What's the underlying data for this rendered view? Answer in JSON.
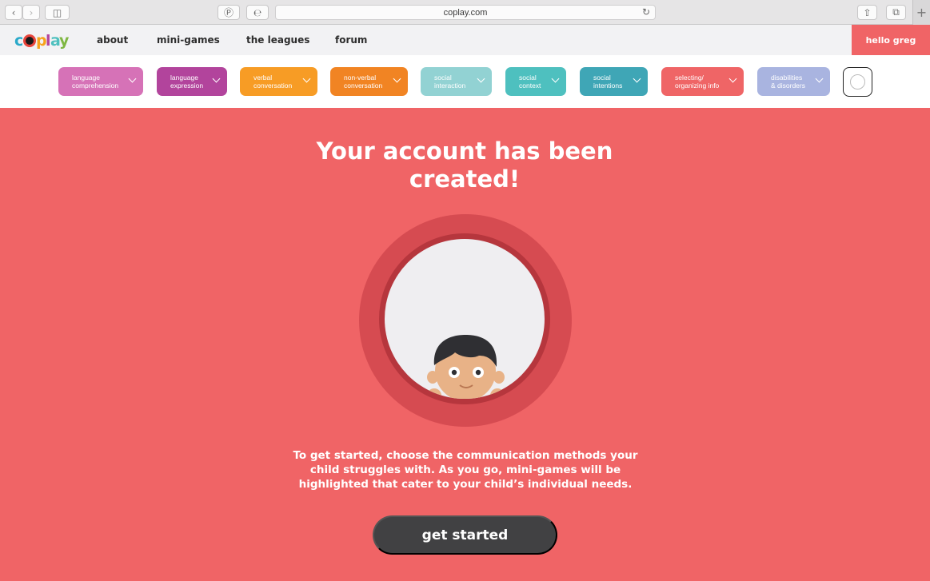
{
  "browser": {
    "url": "coplay.com"
  },
  "nav": {
    "logo": "coplay",
    "links": [
      "about",
      "mini-games",
      "the leagues",
      "forum"
    ],
    "greeting": "hello greg"
  },
  "categories": [
    {
      "label": "language\ncomprehension",
      "color": "#d672b7"
    },
    {
      "label": "language\nexpression",
      "color": "#b2449c"
    },
    {
      "label": "verbal\nconversation",
      "color": "#f79c25"
    },
    {
      "label": "non-verbal\nconversation",
      "color": "#f18423"
    },
    {
      "label": "social\ninteraction",
      "color": "#92d2d3"
    },
    {
      "label": "social\ncontext",
      "color": "#4ec0bf"
    },
    {
      "label": "social\nintentions",
      "color": "#3fa6b6"
    },
    {
      "label": "selecting/\norganizing info",
      "color": "#ef6566"
    },
    {
      "label": "disabilities\n& disorders",
      "color": "#a9b4e0"
    }
  ],
  "main": {
    "headline": "Your account has been created!",
    "body": "To get started, choose the communication methods your child struggles with. As you go,  mini-games will be highlighted that cater to your child’s individual needs.",
    "cta": "get started"
  },
  "colors": {
    "background": "#f06466",
    "nav": "#f2f2f4",
    "cta": "#414143",
    "ring": "#d64b51"
  }
}
